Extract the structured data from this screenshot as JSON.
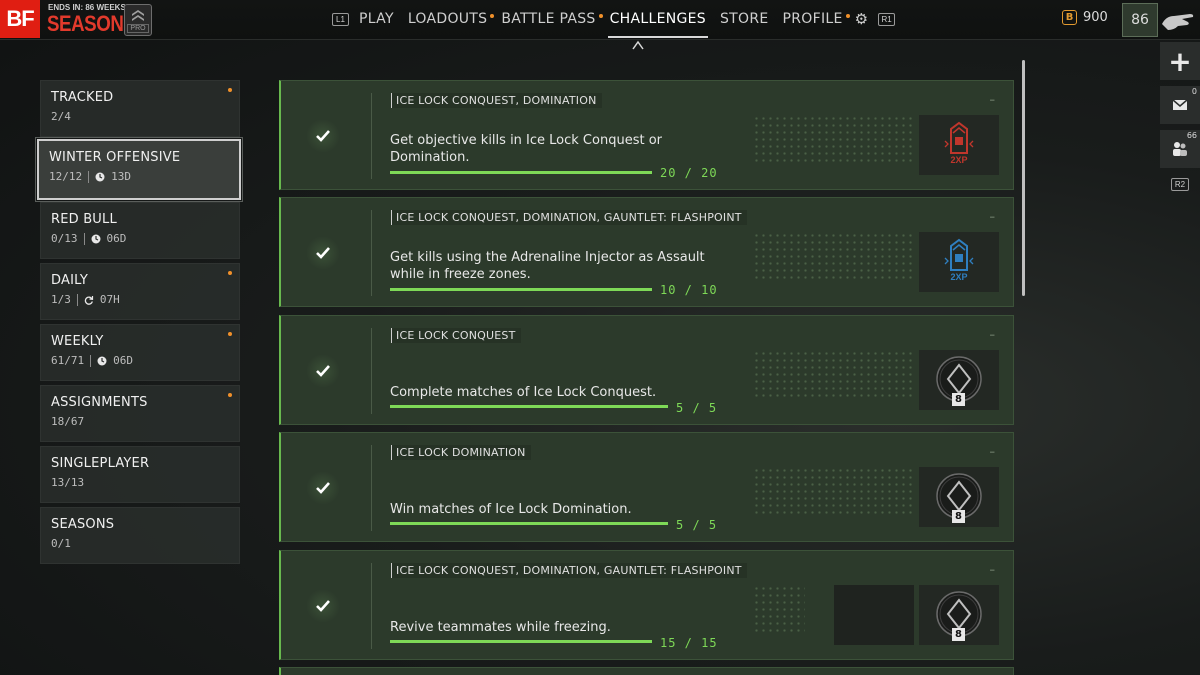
{
  "header": {
    "logo": "BF",
    "season_ends": "ENDS IN: 86 WEEKS",
    "season_title": "SEASON 1",
    "pro_badge": "PRO",
    "hint_left": "L1",
    "hint_right": "R1",
    "nav": [
      {
        "label": "PLAY",
        "active": false,
        "dot": false
      },
      {
        "label": "LOADOUTS",
        "active": false,
        "dot": true
      },
      {
        "label": "BATTLE PASS",
        "active": false,
        "dot": true
      },
      {
        "label": "CHALLENGES",
        "active": true,
        "dot": false
      },
      {
        "label": "STORE",
        "active": false,
        "dot": false
      },
      {
        "label": "PROFILE",
        "active": false,
        "dot": true
      }
    ],
    "currency_amount": "900",
    "level": "86"
  },
  "rail": {
    "mail_count": "0",
    "friends_count": "66",
    "hint": "R2"
  },
  "sidebar": [
    {
      "title": "TRACKED",
      "progress": "2/4",
      "timer": "",
      "timer_icon": "",
      "dot": true,
      "selected": false
    },
    {
      "title": "WINTER OFFENSIVE",
      "progress": "12/12",
      "timer": "13D",
      "timer_icon": "clock-icon",
      "dot": false,
      "selected": true
    },
    {
      "title": "RED BULL",
      "progress": "0/13",
      "timer": "06D",
      "timer_icon": "clock-icon",
      "dot": false,
      "selected": false
    },
    {
      "title": "DAILY",
      "progress": "1/3",
      "timer": "07H",
      "timer_icon": "refresh-icon",
      "dot": true,
      "selected": false
    },
    {
      "title": "WEEKLY",
      "progress": "61/71",
      "timer": "06D",
      "timer_icon": "clock-icon",
      "dot": true,
      "selected": false
    },
    {
      "title": "ASSIGNMENTS",
      "progress": "18/67",
      "timer": "",
      "timer_icon": "",
      "dot": true,
      "selected": false
    },
    {
      "title": "SINGLEPLAYER",
      "progress": "13/13",
      "timer": "",
      "timer_icon": "",
      "dot": false,
      "selected": false
    },
    {
      "title": "SEASONS",
      "progress": "0/1",
      "timer": "",
      "timer_icon": "",
      "dot": false,
      "selected": false
    }
  ],
  "challenges": [
    {
      "tags": "ICE LOCK CONQUEST, DOMINATION",
      "description": "Get objective kills in Ice Lock Conquest or Domination.",
      "progress": "20 / 20",
      "progress_fraction": 1.0,
      "reward_icon": "2xp-red-token-icon",
      "reward_label": "2XP",
      "accent": "#c0362c",
      "completed": true
    },
    {
      "tags": "ICE LOCK CONQUEST, DOMINATION, GAUNTLET: FLASHPOINT",
      "description": "Get kills using the Adrenaline Injector as Assault while in freeze zones.",
      "progress": "10 / 10",
      "progress_fraction": 1.0,
      "reward_icon": "2xp-blue-token-icon",
      "reward_label": "2XP",
      "accent": "#2f7fc0",
      "completed": true
    },
    {
      "tags": "ICE LOCK CONQUEST",
      "description": "Complete matches of Ice Lock Conquest.",
      "progress": "5 / 5",
      "progress_fraction": 1.0,
      "reward_icon": "dogtag-icon",
      "reward_label": "8",
      "completed": true
    },
    {
      "tags": "ICE LOCK DOMINATION",
      "description": "Win matches of Ice Lock Domination.",
      "progress": "5 / 5",
      "progress_fraction": 1.0,
      "reward_icon": "dogtag-icon",
      "reward_label": "8",
      "completed": true
    },
    {
      "tags": "ICE LOCK CONQUEST, DOMINATION, GAUNTLET: FLASHPOINT",
      "description": "Revive teammates while freezing.",
      "progress": "15 / 15",
      "progress_fraction": 1.0,
      "reward_icon": "dogtag-icon",
      "reward_label": "8",
      "extra_reward_icon": "dark-card-icon",
      "completed": true
    }
  ],
  "card_dash": "–"
}
